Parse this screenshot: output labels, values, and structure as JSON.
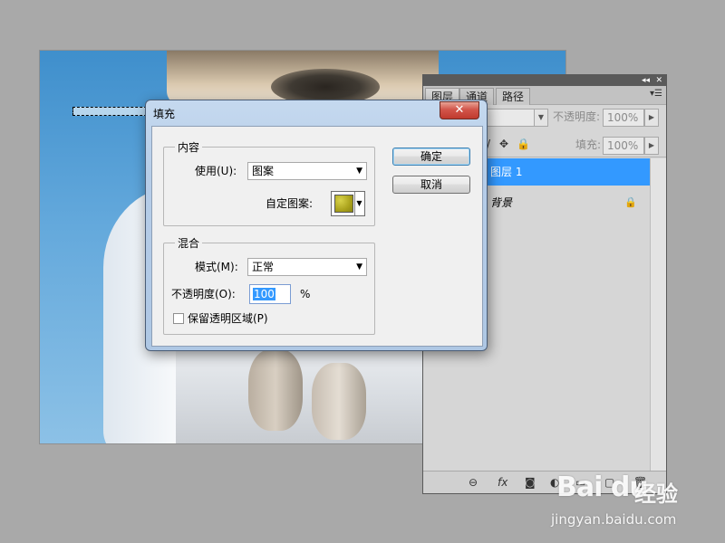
{
  "dialog": {
    "title": "填充",
    "close_label": "✕",
    "content_group": {
      "title": "内容",
      "use_label": "使用(U):",
      "use_value": "图案",
      "custom_pattern_label": "自定图案:"
    },
    "blend_group": {
      "title": "混合",
      "mode_label": "模式(M):",
      "mode_value": "正常",
      "opacity_label": "不透明度(O):",
      "opacity_value": "100",
      "opacity_unit": "%",
      "preserve_label": "保留透明区域(P)",
      "preserve_checked": false
    },
    "ok_label": "确定",
    "cancel_label": "取消",
    "pattern_color": "#bdb527"
  },
  "layers_panel": {
    "collapse_icon": "◂◂",
    "close_icon": "✕",
    "tabs": [
      {
        "label": "图层",
        "active": true
      },
      {
        "label": "通道",
        "active": false
      },
      {
        "label": "路径",
        "active": false
      }
    ],
    "opacity_label": "不透明度:",
    "opacity_value": "100%",
    "fill_label": "填充:",
    "fill_value": "100%",
    "layers": [
      {
        "name": "图层 1",
        "selected": true
      },
      {
        "name": "背景",
        "selected": false
      }
    ],
    "selection_color": "#3399ff"
  },
  "watermark": {
    "logo": "Bai du",
    "brand": "经验",
    "url": "jingyan.baidu.com"
  }
}
